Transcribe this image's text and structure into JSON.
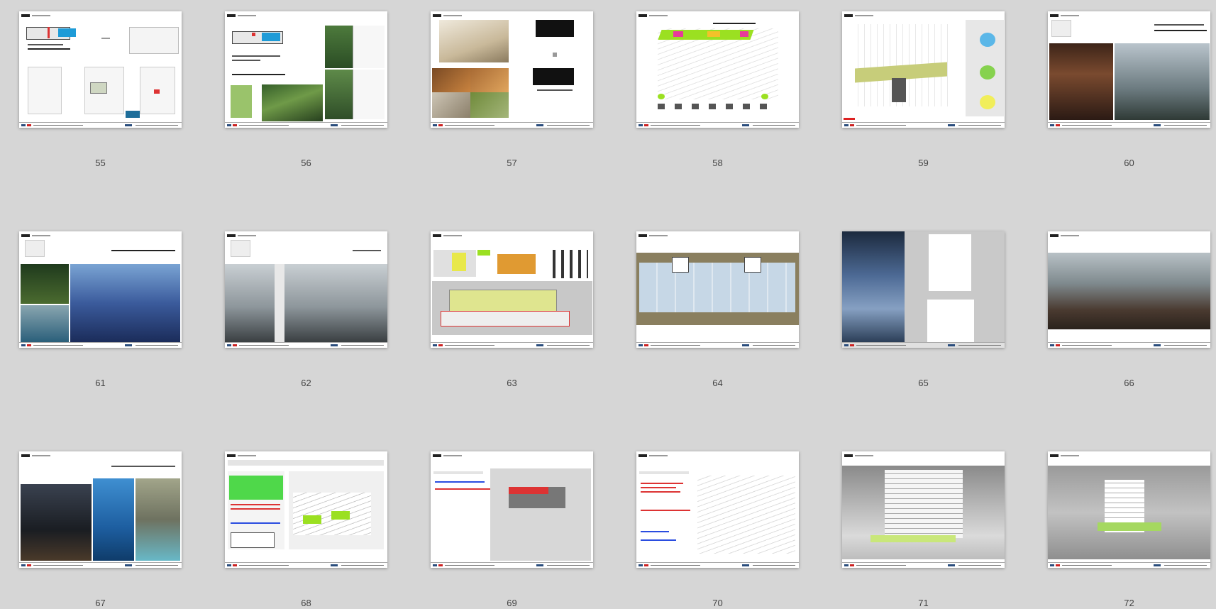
{
  "view": "slide-sorter",
  "slides": [
    {
      "number": "55"
    },
    {
      "number": "56"
    },
    {
      "number": "57"
    },
    {
      "number": "58"
    },
    {
      "number": "59"
    },
    {
      "number": "60"
    },
    {
      "number": "61"
    },
    {
      "number": "62"
    },
    {
      "number": "63"
    },
    {
      "number": "64"
    },
    {
      "number": "65"
    },
    {
      "number": "66"
    },
    {
      "number": "67"
    },
    {
      "number": "68"
    },
    {
      "number": "69"
    },
    {
      "number": "70"
    },
    {
      "number": "71"
    },
    {
      "number": "72"
    }
  ]
}
